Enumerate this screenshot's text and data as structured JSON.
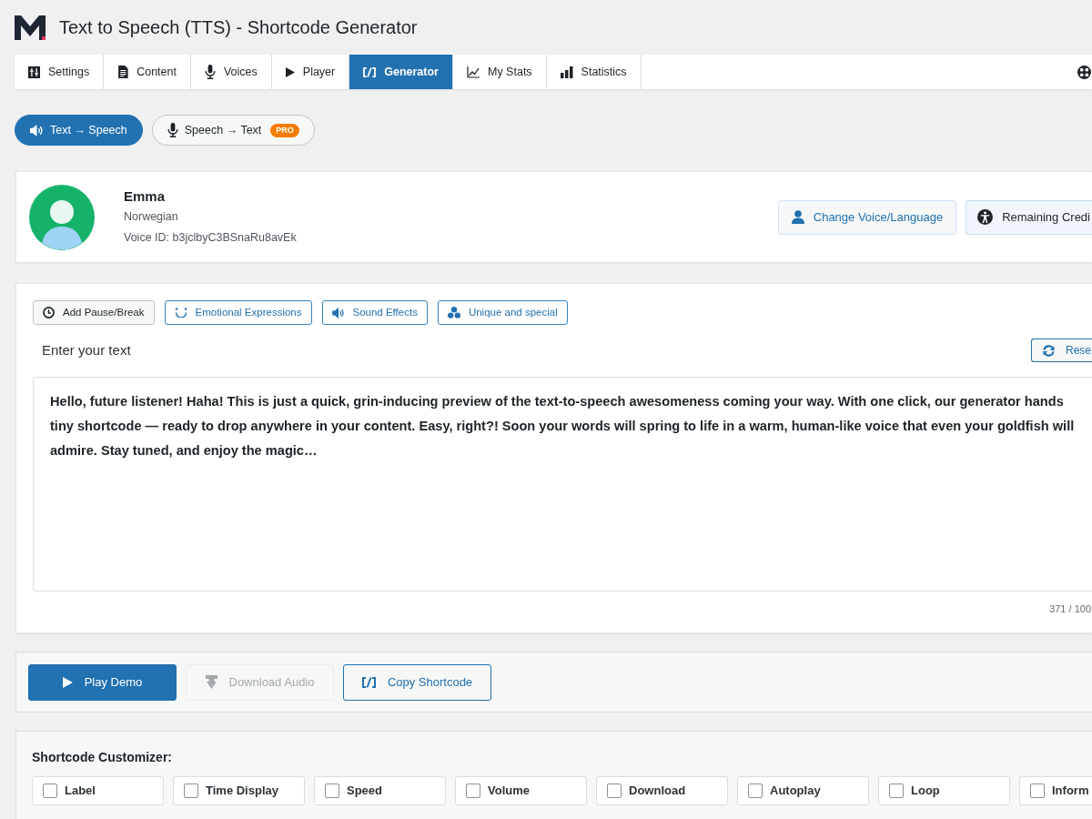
{
  "header": {
    "title": "Text to Speech (TTS) - Shortcode Generator"
  },
  "tabs": [
    {
      "label": "Settings",
      "selected": false
    },
    {
      "label": "Content",
      "selected": false
    },
    {
      "label": "Voices",
      "selected": false
    },
    {
      "label": "Player",
      "selected": false
    },
    {
      "label": "Generator",
      "selected": true
    },
    {
      "label": "My Stats",
      "selected": false
    },
    {
      "label": "Statistics",
      "selected": false
    }
  ],
  "mode_toggle": [
    {
      "label": "Text → Speech",
      "selected": true
    },
    {
      "label": "Speech → Text",
      "selected": false,
      "badge": "PRO"
    }
  ],
  "voice": {
    "name": "Emma",
    "language": "Norwegian",
    "voice_id": "Voice ID: b3jclbyC3BSnaRu8avEk",
    "buttons": [
      {
        "label": "Change Voice/Language",
        "kind": "accent"
      },
      {
        "label": "Remaining Credi",
        "kind": "info"
      }
    ]
  },
  "editor": {
    "tools": [
      {
        "label": "Add Pause/Break",
        "kind": "neutral"
      },
      {
        "label": "Emotional Expressions",
        "kind": "accent"
      },
      {
        "label": "Sound Effects",
        "kind": "accent"
      },
      {
        "label": "Unique and special",
        "kind": "accent"
      }
    ],
    "label": "Enter your text",
    "reset_button": "Rese",
    "text": "Hello, future listener! Haha! This is just a quick, grin-inducing preview of the text-to-speech awesomeness coming your way. With one click, our generator hands tiny shortcode — ready to drop anywhere in your content. Easy, right?! Soon your words will spring to life in a warm, human-like voice that even your goldfish will admire. Stay tuned, and enjoy the magic…",
    "char_count": "371 / 100"
  },
  "actions": [
    {
      "label": "Play Demo",
      "kind": "primary",
      "disabled": false
    },
    {
      "label": "Download Audio",
      "kind": "plain",
      "disabled": true
    },
    {
      "label": "Copy Shortcode",
      "kind": "outline",
      "disabled": false
    }
  ],
  "customizer": {
    "title": "Shortcode Customizer:",
    "options": [
      {
        "label": "Label",
        "checked": false
      },
      {
        "label": "Time Display",
        "checked": false
      },
      {
        "label": "Speed",
        "checked": false
      },
      {
        "label": "Volume",
        "checked": false
      },
      {
        "label": "Download",
        "checked": false
      },
      {
        "label": "Autoplay",
        "checked": false
      },
      {
        "label": "Loop",
        "checked": false
      },
      {
        "label": "Inform",
        "checked": false
      }
    ]
  }
}
